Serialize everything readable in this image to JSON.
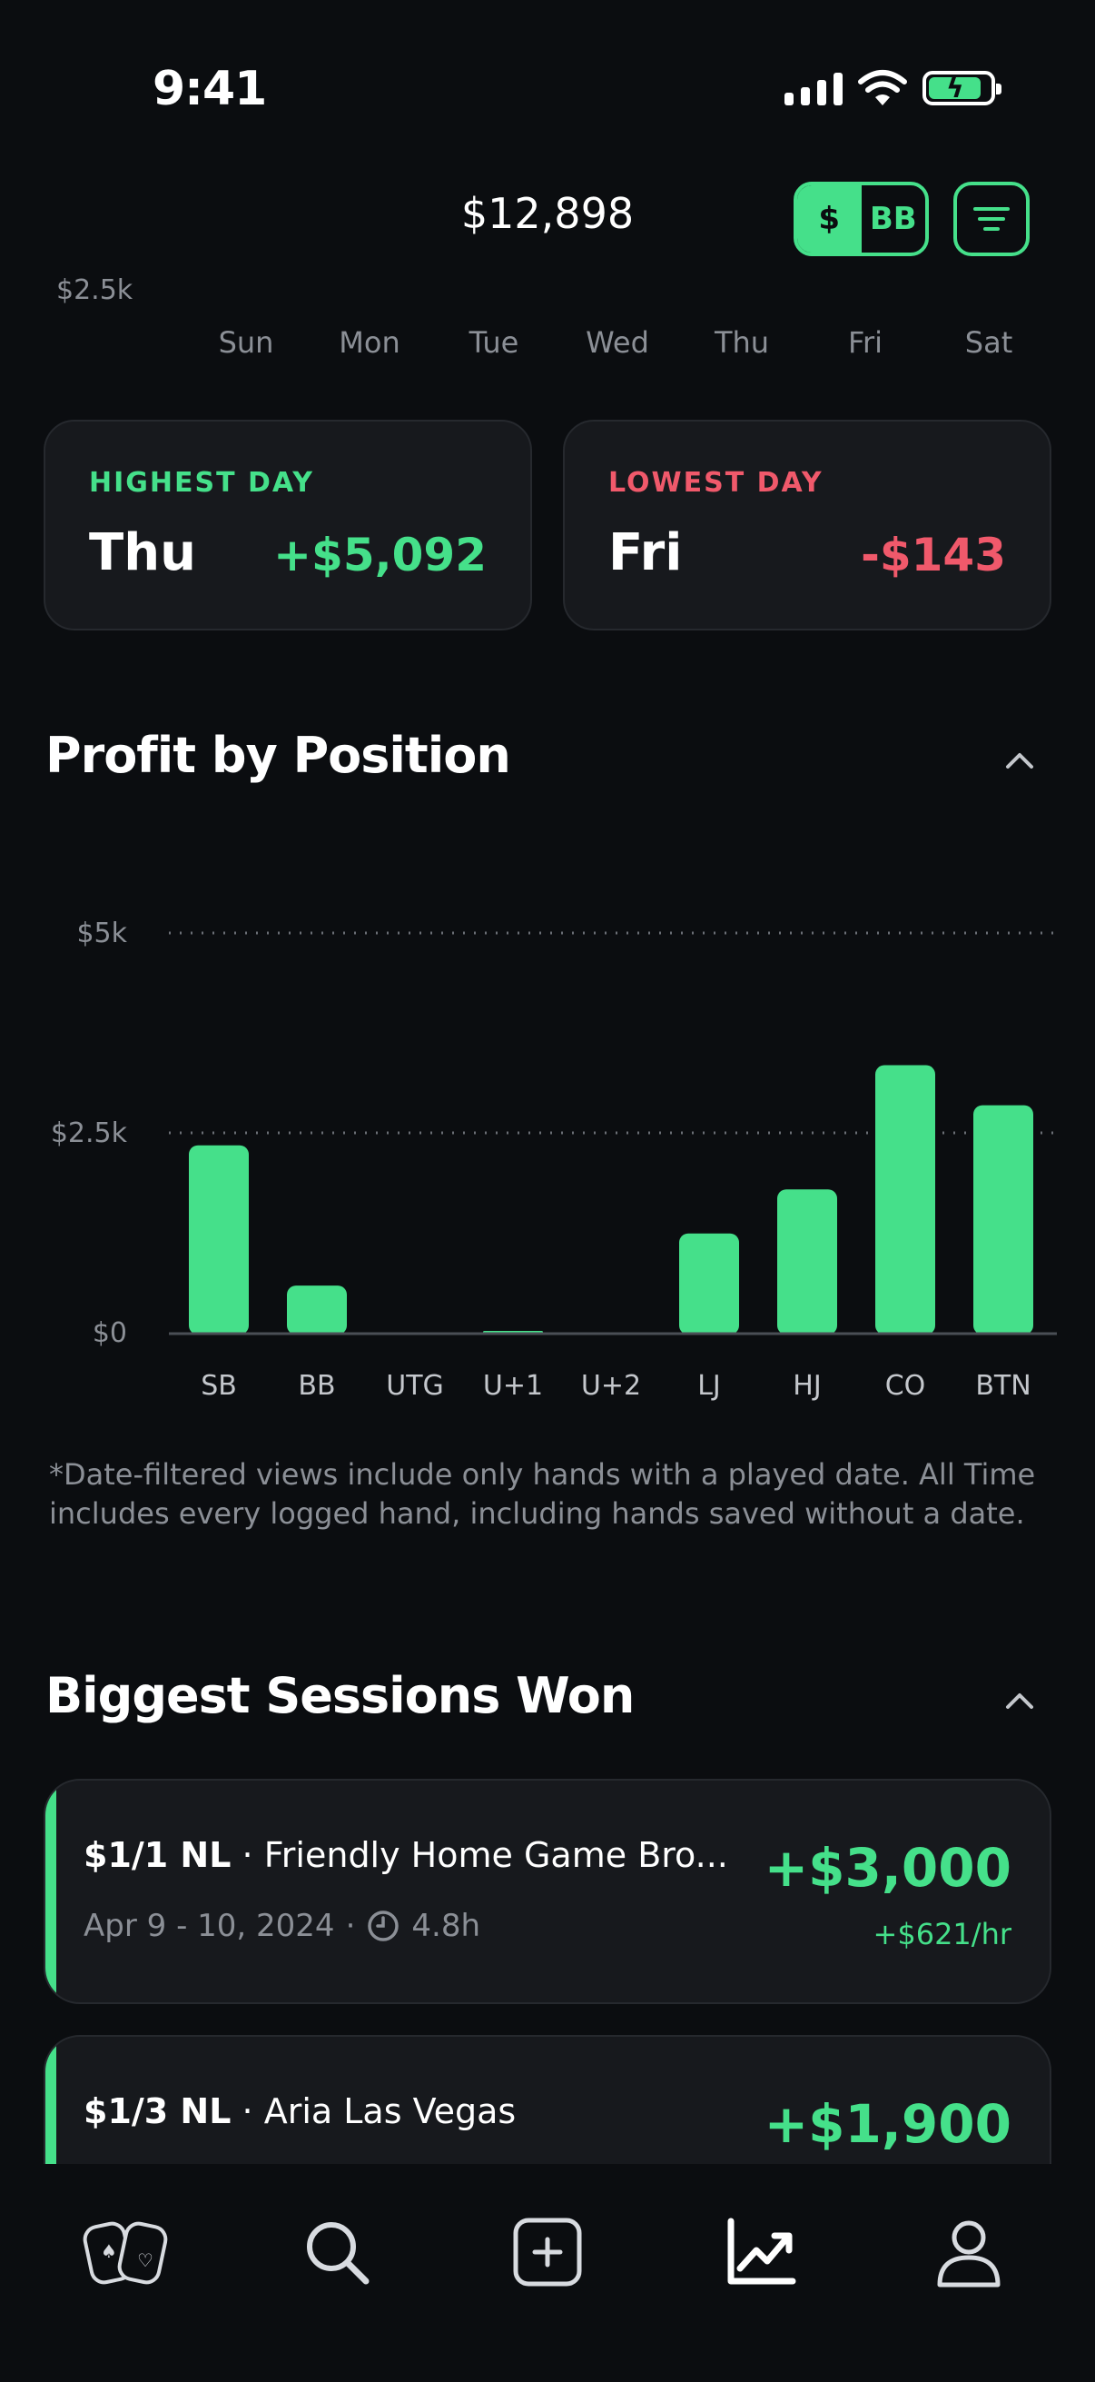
{
  "status_bar": {
    "time": "9:41"
  },
  "header": {
    "balance": "$12,898",
    "toggle_dollar": "$",
    "toggle_bb": "BB"
  },
  "week_chart": {
    "cut_tick": "$2.5k",
    "days": [
      "Sun",
      "Mon",
      "Tue",
      "Wed",
      "Thu",
      "Fri",
      "Sat"
    ]
  },
  "highest_day": {
    "label": "HIGHEST DAY",
    "day": "Thu",
    "amount": "+$5,092"
  },
  "lowest_day": {
    "label": "LOWEST DAY",
    "day": "Fri",
    "amount": "-$143"
  },
  "position_section": {
    "title": "Profit by Position"
  },
  "chart_data": {
    "type": "bar",
    "title": "Profit by Position",
    "categories": [
      "SB",
      "BB",
      "UTG",
      "U+1",
      "U+2",
      "LJ",
      "HJ",
      "CO",
      "BTN"
    ],
    "values": [
      2350,
      600,
      0,
      30,
      0,
      1250,
      1800,
      3350,
      2850
    ],
    "ylim": [
      0,
      5000
    ],
    "yticks": [
      "$5k",
      "$2.5k",
      "$0"
    ],
    "grid": "dotted",
    "bar_color": "#45e08a"
  },
  "note": "*Date-filtered views include only hands with a played date. All Time includes every logged hand, including hands saved without a date.",
  "sessions_section": {
    "title": "Biggest Sessions Won"
  },
  "sessions": [
    {
      "stakes": "$1/1 NL",
      "venue": "Friendly Home Game Bro...",
      "dates": "Apr 9 - 10, 2024",
      "duration": "4.8h",
      "amount": "+$3,000",
      "rate": "+$621/hr"
    },
    {
      "stakes": "$1/3 NL",
      "venue": "Aria Las Vegas",
      "amount": "+$1,900"
    }
  ],
  "tabs": [
    "cards-icon",
    "search-icon",
    "add-icon",
    "stats-icon",
    "profile-icon"
  ],
  "colors": {
    "accent": "#45e08a",
    "negative": "#f0596b",
    "background": "#0b0d10",
    "card": "#17191d"
  }
}
